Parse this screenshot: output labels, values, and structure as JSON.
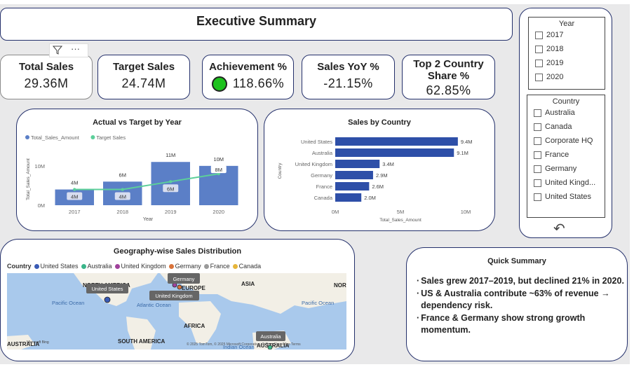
{
  "title": "Executive Summary",
  "kpis": {
    "total_sales": {
      "label": "Total Sales",
      "value": "29.36M"
    },
    "target_sales": {
      "label": "Target Sales",
      "value": "24.74M"
    },
    "achievement": {
      "label": "Achievement %",
      "value": "118.66%",
      "indicator_color": "#1ec21e"
    },
    "sales_yoy": {
      "label": "Sales YoY %",
      "value": "-21.15%"
    },
    "top2_share": {
      "label": "Top 2 Country Share %",
      "value": "62.85%"
    }
  },
  "visual_header": {
    "filter_icon": "filter-icon",
    "more_icon": "more-options-icon",
    "more_text": "···"
  },
  "chart_data": [
    {
      "type": "bar",
      "title": "Actual vs Target by Year",
      "legend": [
        "Total_Sales_Amount",
        "Target Sales"
      ],
      "legend_placement": "top-left",
      "categories": [
        "2017",
        "2018",
        "2019",
        "2020"
      ],
      "series": [
        {
          "name": "Total_Sales_Amount",
          "type": "bar",
          "values": [
            4,
            6,
            11,
            10
          ],
          "labels": [
            "4M",
            "6M",
            "11M",
            "10M"
          ],
          "color": "#5b7fc7"
        },
        {
          "name": "Target Sales",
          "type": "line",
          "values": [
            4,
            4,
            6,
            8
          ],
          "labels": [
            "4M",
            "4M",
            "6M",
            "8M"
          ],
          "color": "#5ccf9a"
        }
      ],
      "xlabel": "Year",
      "ylabel": "Total_Sales_Amount",
      "ytick_labels": [
        "0M",
        "10M"
      ],
      "ylim": [
        0,
        13
      ],
      "grid": false
    },
    {
      "type": "bar",
      "orientation": "horizontal",
      "title": "Sales by Country",
      "categories": [
        "United States",
        "Australia",
        "United Kingdom",
        "Germany",
        "France",
        "Canada"
      ],
      "values": [
        9.4,
        9.1,
        3.4,
        2.9,
        2.6,
        2.0
      ],
      "labels": [
        "9.4M",
        "9.1M",
        "3.4M",
        "2.9M",
        "2.6M",
        "2.0M"
      ],
      "xlabel": "Total_Sales_Amount",
      "ylabel": "Country",
      "xtick_labels": [
        "0M",
        "5M",
        "10M"
      ],
      "xlim": [
        0,
        10
      ],
      "color": "#2e4fa8"
    }
  ],
  "slicers": {
    "year": {
      "title": "Year",
      "options": [
        "2017",
        "2018",
        "2019",
        "2020"
      ]
    },
    "country": {
      "title": "Country",
      "options": [
        "Australia",
        "Canada",
        "Corporate HQ",
        "France",
        "Germany",
        "United Kingd...",
        "United States"
      ]
    },
    "reset_icon": "undo-icon",
    "reset_glyph": "↶"
  },
  "map": {
    "title": "Geography-wise Sales Distribution",
    "legend_title": "Country",
    "legend": [
      {
        "name": "United States",
        "color": "#3a5bb5"
      },
      {
        "name": "Australia",
        "color": "#3bb58a"
      },
      {
        "name": "United Kingdom",
        "color": "#a0429c"
      },
      {
        "name": "Germany",
        "color": "#d9733a"
      },
      {
        "name": "France",
        "color": "#9a9a9a"
      },
      {
        "name": "Canada",
        "color": "#e6b53a"
      }
    ],
    "labels": {
      "north_america": "NORTH AMERICA",
      "europe": "EUROPE",
      "asia": "ASIA",
      "nor": "NOR",
      "africa": "AFRICA",
      "south_america": "SOUTH AMERICA",
      "australia_region": "AUSTRALIA",
      "australia_left": "AUSTRALIA",
      "pacific_left": "Pacific Ocean",
      "atlantic": "Atlantic Ocean",
      "pacific_right": "Pacific Ocean",
      "indian": "Indian Ocean"
    },
    "tooltips": {
      "us": "United States",
      "germany": "Germany",
      "uk": "United Kingdom",
      "australia": "Australia"
    },
    "attribution": "© 2025 TomTom, © 2025 Microsoft Corporation, © OpenStreetMap  Terms",
    "microsoft_logo": "Microsoft Bing"
  },
  "quick_summary": {
    "title": "Quick Summary",
    "bullet_char": "·",
    "items": [
      "Sales grew 2017–2019, but declined 21% in 2020.",
      "US & Australia contribute ~63% of revenue → dependency risk.",
      "France & Germany show strong growth momentum."
    ]
  },
  "colors": {
    "card_border": "#24306b",
    "canvas_bg": "#e9e9ea",
    "bar_blue": "#5b7fc7",
    "hbar_blue": "#2e4fa8",
    "target_line": "#5ccf9a"
  }
}
